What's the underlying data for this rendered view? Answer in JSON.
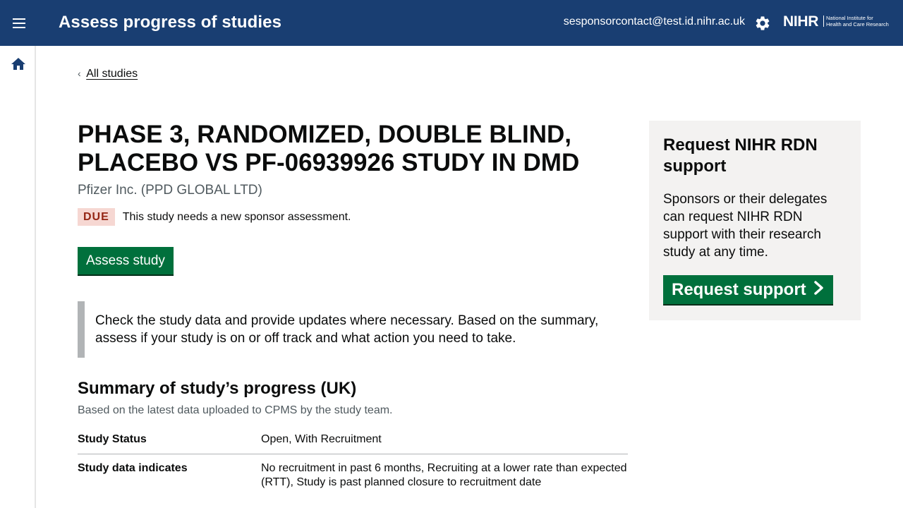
{
  "header": {
    "app_title": "Assess progress of studies",
    "user_email": "sesponsorcontact@test.id.nihr.ac.uk",
    "logo_main": "NIHR",
    "logo_sub_line1": "National Institute for",
    "logo_sub_line2": "Health and Care Research",
    "icons": {
      "menu": "menu-icon",
      "settings": "gear-icon"
    }
  },
  "side_nav": {
    "home_icon": "home-icon"
  },
  "breadcrumb": {
    "back_label": "All studies"
  },
  "study": {
    "title": "PHASE 3, RANDOMIZED, DOUBLE BLIND, PLACEBO VS PF-06939926 STUDY IN DMD",
    "sponsor": "Pfizer Inc. (PPD GLOBAL LTD)",
    "status_badge": "DUE",
    "status_text": "This study needs a new sponsor assessment.",
    "assess_button": "Assess study",
    "inset_text": "Check the study data and provide updates where necessary. Based on the summary, assess if your study is on or off track and what action you need to take."
  },
  "summary": {
    "heading": "Summary of study’s progress (UK)",
    "subheading": "Based on the latest data uploaded to CPMS by the study team.",
    "rows": [
      {
        "key": "Study Status",
        "value": "Open, With Recruitment"
      },
      {
        "key": "Study data indicates",
        "value": "No recruitment in past 6 months, Recruiting at a lower rate than expected (RTT), Study is past planned closure to recruitment date"
      }
    ]
  },
  "support_panel": {
    "title": "Request NIHR RDN support",
    "text": "Sponsors or their delegates can request NIHR RDN support with their research study at any time.",
    "button": "Request support"
  },
  "colors": {
    "header_bg": "#193e72",
    "primary_button": "#00703c",
    "due_badge_bg": "#f6d7d2",
    "due_badge_text": "#942514",
    "panel_bg": "#f3f2f1",
    "inset_border": "#b1b4b6"
  }
}
